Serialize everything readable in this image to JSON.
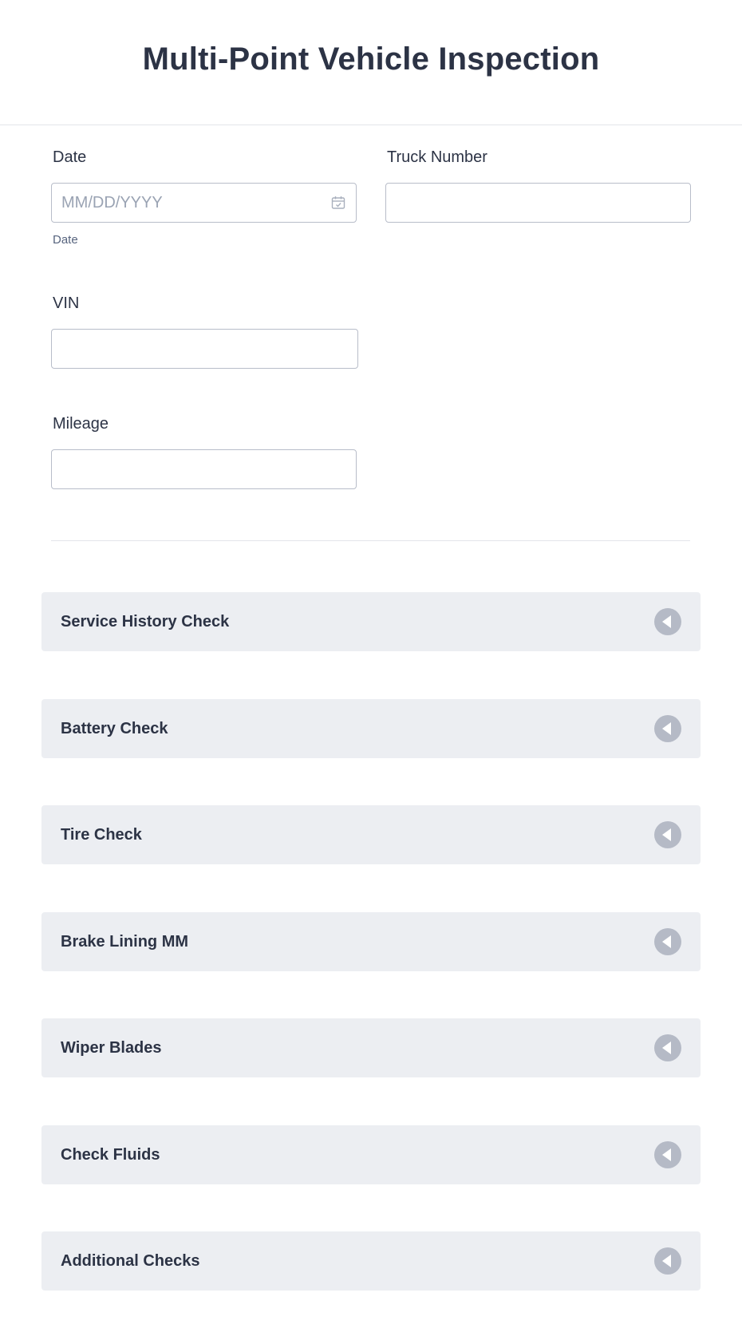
{
  "form": {
    "title": "Multi-Point Vehicle Inspection"
  },
  "fields": {
    "date": {
      "label": "Date",
      "placeholder": "MM/DD/YYYY",
      "sublabel": "Date",
      "value": ""
    },
    "truck_number": {
      "label": "Truck Number",
      "value": ""
    },
    "vin": {
      "label": "VIN",
      "value": ""
    },
    "mileage": {
      "label": "Mileage",
      "value": ""
    }
  },
  "sections": [
    {
      "title": "Service History Check",
      "icon": "collapse-arrow-icon"
    },
    {
      "title": "Battery Check",
      "icon": "collapse-arrow-icon"
    },
    {
      "title": "Tire Check",
      "icon": "collapse-arrow-icon"
    },
    {
      "title": "Brake Lining MM",
      "icon": "collapse-arrow-icon"
    },
    {
      "title": "Wiper Blades",
      "icon": "collapse-arrow-icon"
    },
    {
      "title": "Check Fluids",
      "icon": "collapse-arrow-icon"
    },
    {
      "title": "Additional Checks",
      "icon": "collapse-arrow-icon"
    }
  ],
  "colors": {
    "text": "#2c3345",
    "section_bg": "#eceef2",
    "icon_bg": "#b5bac6",
    "input_border": "#b8bdc9",
    "divider": "#e3e5ea"
  }
}
